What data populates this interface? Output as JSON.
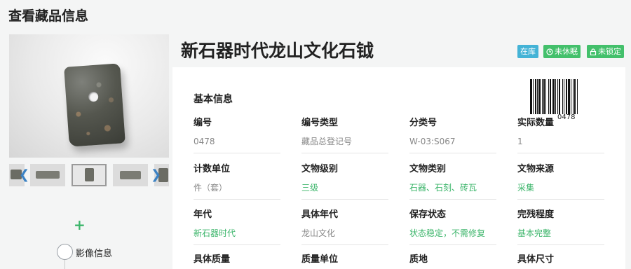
{
  "page": {
    "title": "查看藏品信息"
  },
  "item": {
    "title": "新石器时代龙山文化石钺"
  },
  "badges": [
    {
      "label": "在库",
      "color": "#44b3d6",
      "icon": ""
    },
    {
      "label": "未休眠",
      "color": "#43c06b",
      "icon": "clock-icon"
    },
    {
      "label": "未锁定",
      "color": "#43c06b",
      "icon": "lock-icon"
    }
  ],
  "gallery": {
    "thumbnail_count": 5,
    "active_index": 2
  },
  "timeline": {
    "node_label": "影像信息"
  },
  "basic_info": {
    "section_title": "基本信息",
    "barcode_number": "0478",
    "fields": [
      {
        "label": "编号",
        "value": "0478",
        "style": "plain"
      },
      {
        "label": "编号类型",
        "value": "藏品总登记号",
        "style": "plain"
      },
      {
        "label": "分类号",
        "value": "W-03:S067",
        "style": "plain"
      },
      {
        "label": "实际数量",
        "value": "1",
        "style": "plain"
      },
      {
        "label": "计数单位",
        "value": "件（套）",
        "style": "plain"
      },
      {
        "label": "文物级别",
        "value": "三级",
        "style": "green"
      },
      {
        "label": "文物类别",
        "value": "石器、石刻、砖瓦",
        "style": "green"
      },
      {
        "label": "文物来源",
        "value": "采集",
        "style": "green"
      },
      {
        "label": "年代",
        "value": "新石器时代",
        "style": "green"
      },
      {
        "label": "具体年代",
        "value": "龙山文化",
        "style": "plain"
      },
      {
        "label": "保存状态",
        "value": "状态稳定，不需修复",
        "style": "green"
      },
      {
        "label": "完残程度",
        "value": "基本完整",
        "style": "green"
      },
      {
        "label": "具体质量",
        "value": "",
        "style": "plain"
      },
      {
        "label": "质量单位",
        "value": "",
        "style": "plain"
      },
      {
        "label": "质地",
        "value": "",
        "style": "plain"
      },
      {
        "label": "具体尺寸",
        "value": "",
        "style": "plain"
      }
    ]
  }
}
